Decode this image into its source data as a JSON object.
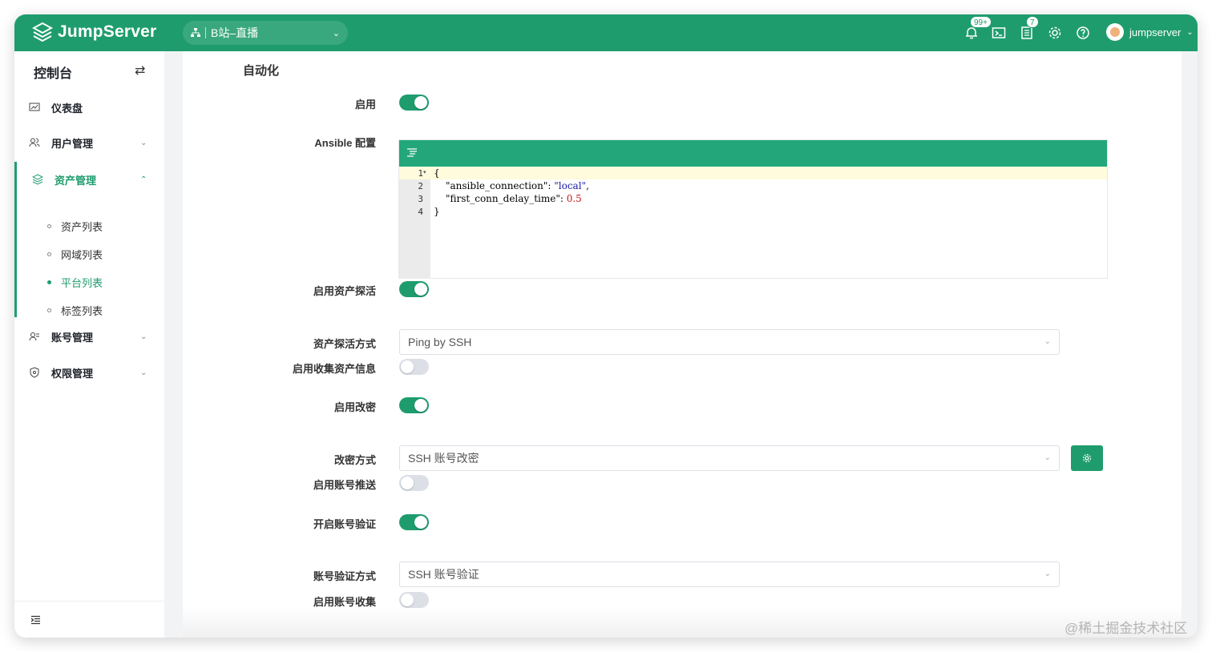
{
  "topbar": {
    "brand": "JumpServer",
    "org": "B站–直播",
    "notifications_badge": "99+",
    "tasks_badge": "7",
    "username": "jumpserver"
  },
  "sidebar": {
    "header": "控制台",
    "items": [
      {
        "label": "仪表盘",
        "icon": "dashboard-icon"
      },
      {
        "label": "用户管理",
        "icon": "users-icon"
      },
      {
        "label": "资产管理",
        "icon": "layers-icon"
      },
      {
        "label": "账号管理",
        "icon": "account-icon"
      },
      {
        "label": "权限管理",
        "icon": "shield-icon"
      }
    ],
    "sub_items": [
      "资产列表",
      "网域列表",
      "平台列表",
      "标签列表"
    ]
  },
  "form": {
    "section_title": "自动化",
    "enable_label": "启用",
    "ansible_label": "Ansible 配置",
    "ping_enabled_label": "启用资产探活",
    "ping_method_label": "资产探活方式",
    "ping_method_value": "Ping by SSH",
    "gather_facts_label": "启用收集资产信息",
    "change_secret_label": "启用改密",
    "change_method_label": "改密方式",
    "change_method_value": "SSH 账号改密",
    "push_label": "启用账号推送",
    "verify_enabled_label": "开启账号验证",
    "verify_method_label": "账号验证方式",
    "verify_method_value": "SSH 账号验证",
    "gather_accounts_label": "启用账号收集",
    "switches": {
      "enable": true,
      "ping": true,
      "gather_facts": false,
      "change_secret": true,
      "push": false,
      "verify": true,
      "gather_accounts": false
    }
  },
  "editor": {
    "line_numbers": [
      "1",
      "2",
      "3",
      "4"
    ],
    "open_brace": "{",
    "key1": "\"ansible_connection\"",
    "val1": "\"local\"",
    "key2": "\"first_conn_delay_time\"",
    "val2": "0.5",
    "close_brace": "}"
  },
  "watermark": "@稀土掘金技术社区",
  "colors": {
    "primary": "#1f9c6e",
    "editor_bar": "#23a77a"
  }
}
